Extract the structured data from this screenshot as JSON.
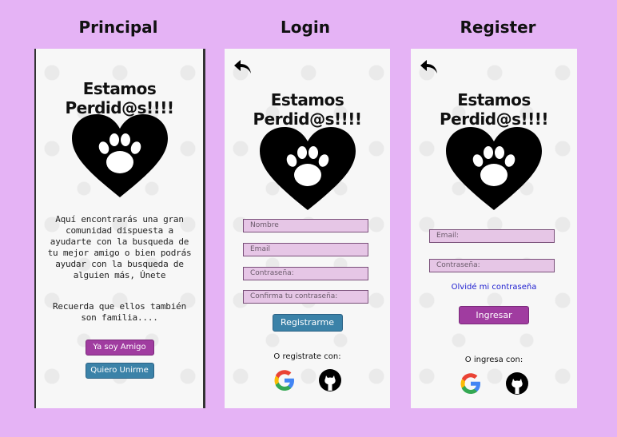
{
  "headings": {
    "principal": "Principal",
    "login": "Login",
    "register": "Register"
  },
  "principal": {
    "title": "Estamos Perdid@s!!!!",
    "description": "Aquí encontrarás una gran comunidad dispuesta a ayudarte con la busqueda de tu mejor amigo o bien podrás ayudar con la busqueda de alguien más, Únete",
    "reminder": "Recuerda que ellos también son familia....",
    "btn_amigo": "Ya soy Amigo",
    "btn_unirme": "Quiero Unirme"
  },
  "login": {
    "title": "Estamos Perdid@s!!!!",
    "fields": {
      "name_placeholder": "Nombre",
      "email_placeholder": "Email",
      "password_placeholder": "Contraseña:",
      "confirm_placeholder": "Confirma tu contraseña:"
    },
    "submit_label": "Registrarme",
    "or_text": "O registrate con:"
  },
  "register": {
    "title": "Estamos Perdid@s!!!!",
    "fields": {
      "email_placeholder": "Email:",
      "password_placeholder": "Contraseña:"
    },
    "forgot_label": "Olvidé mi contraseña",
    "submit_label": "Ingresar",
    "or_text": "O ingresa con:"
  },
  "colors": {
    "background": "#e5b3f5",
    "button_purple": "#a03ca0",
    "button_blue": "#3b82a8",
    "field_bg": "#e6c6e6",
    "link": "#2020d0"
  },
  "icons": [
    "back-arrow-icon",
    "heart-paw-icon",
    "google-icon",
    "github-icon"
  ]
}
